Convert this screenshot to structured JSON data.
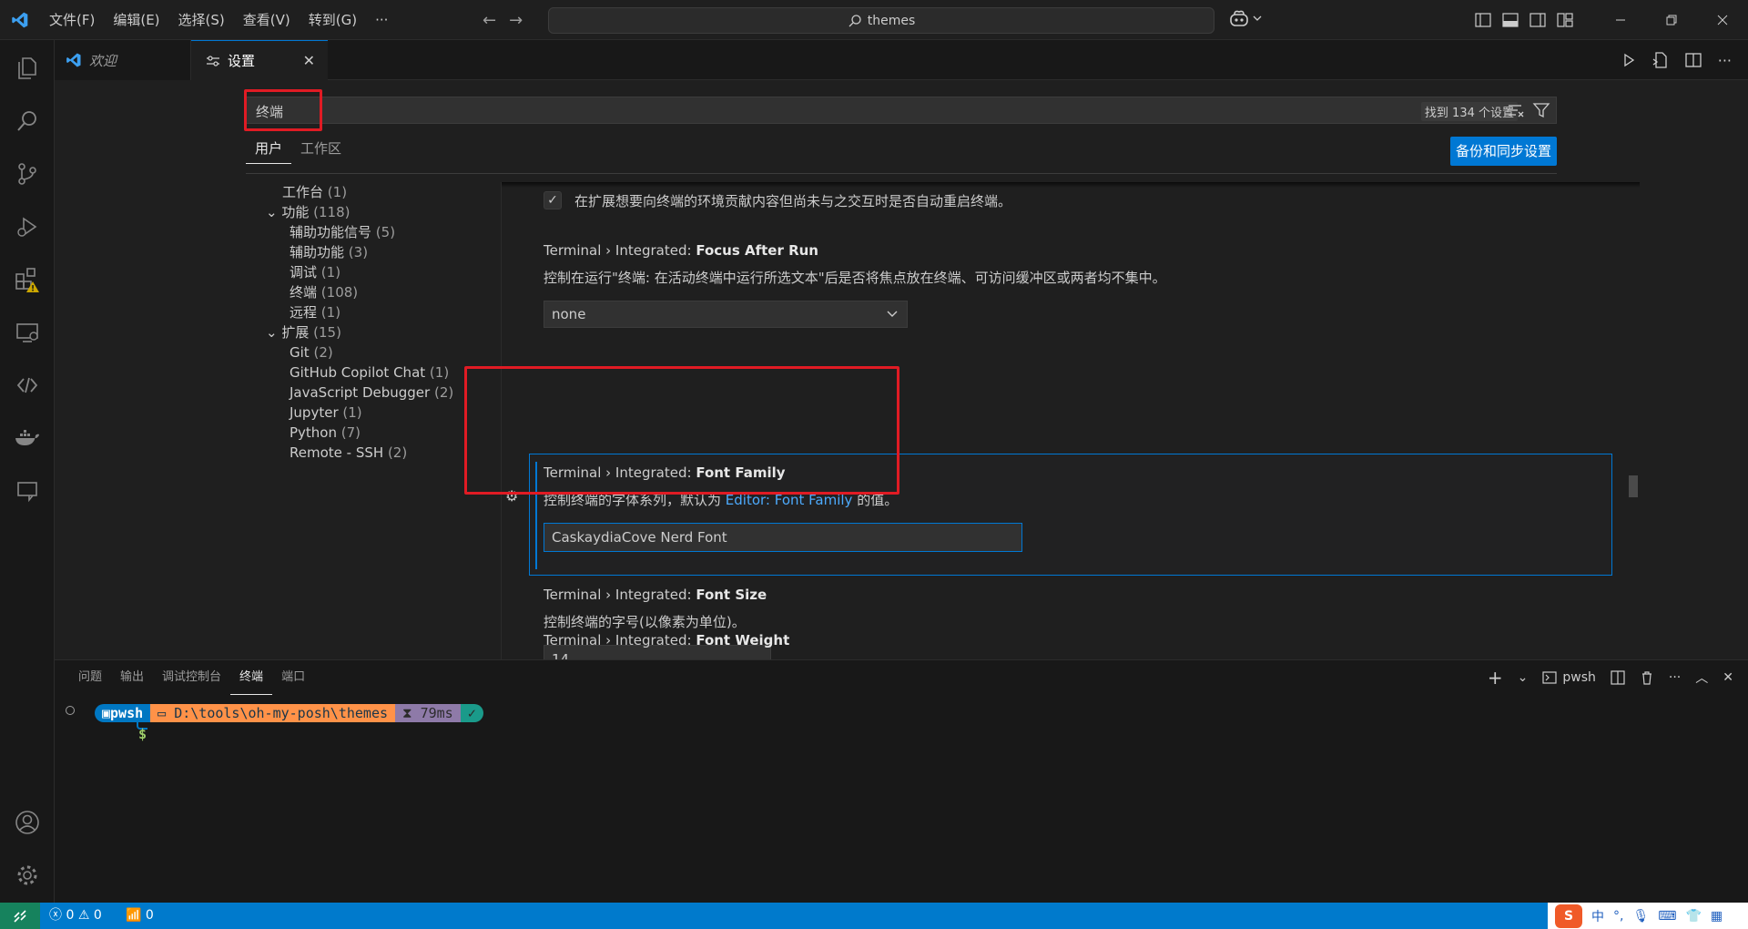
{
  "menu": [
    "文件(F)",
    "编辑(E)",
    "选择(S)",
    "查看(V)",
    "转到(G)",
    "···"
  ],
  "command_center": {
    "text": "themes"
  },
  "tabs": {
    "welcome": "欢迎",
    "settings": "设置"
  },
  "search": {
    "value": "终端",
    "result_count": "找到 134 个设置"
  },
  "scope": {
    "user": "用户",
    "workspace": "工作区",
    "sync_button": "备份和同步设置"
  },
  "toc": [
    {
      "label": "工作台",
      "count": "(1)"
    },
    {
      "label": "功能",
      "count": "(118)"
    },
    {
      "label": "辅助功能信号",
      "count": "(5)"
    },
    {
      "label": "辅助功能",
      "count": "(3)"
    },
    {
      "label": "调试",
      "count": "(1)"
    },
    {
      "label": "终端",
      "count": "(108)"
    },
    {
      "label": "远程",
      "count": "(1)"
    },
    {
      "label": "扩展",
      "count": "(15)"
    },
    {
      "label": "Git",
      "count": "(2)"
    },
    {
      "label": "GitHub Copilot Chat",
      "count": "(1)"
    },
    {
      "label": "JavaScript Debugger",
      "count": "(2)"
    },
    {
      "label": "Jupyter",
      "count": "(1)"
    },
    {
      "label": "Python",
      "count": "(7)"
    },
    {
      "label": "Remote - SSH",
      "count": "(2)"
    }
  ],
  "settings": {
    "env_relaunch": {
      "desc": "在扩展想要向终端的环境贡献内容但尚未与之交互时是否自动重启终端。"
    },
    "focus_after_run": {
      "prefix": "Terminal › Integrated: ",
      "name": "Focus After Run",
      "desc": "控制在运行\"终端: 在活动终端中运行所选文本\"后是否将焦点放在终端、可访问缓冲区或两者均不集中。",
      "value": "none"
    },
    "font_family": {
      "prefix": "Terminal › Integrated: ",
      "name": "Font Family",
      "desc_before": "控制终端的字体系列，默认为 ",
      "desc_link": "Editor: Font Family",
      "desc_after": " 的值。",
      "value": "CaskaydiaCove Nerd Font"
    },
    "font_size": {
      "prefix": "Terminal › Integrated: ",
      "name": "Font Size",
      "desc": "控制终端的字号(以像素为单位)。",
      "value": "14"
    },
    "font_weight": {
      "prefix": "Terminal › Integrated: ",
      "name": "Font Weight"
    }
  },
  "panel": {
    "tabs": [
      "问题",
      "输出",
      "调试控制台",
      "终端",
      "端口"
    ],
    "active_tab": "终端",
    "shell_name": "pwsh"
  },
  "terminal": {
    "shell": "pwsh",
    "path": "D:\\tools\\oh-my-posh\\themes",
    "time": "79ms",
    "ok": "✓",
    "prompt_char": "$"
  },
  "statusbar": {
    "errors": "0",
    "warnings": "0",
    "ports": "0",
    "ime_lang": "中"
  },
  "colors": {
    "accent": "#0078d4",
    "statusbar": "#007acc",
    "highlight": "#e01b24"
  }
}
